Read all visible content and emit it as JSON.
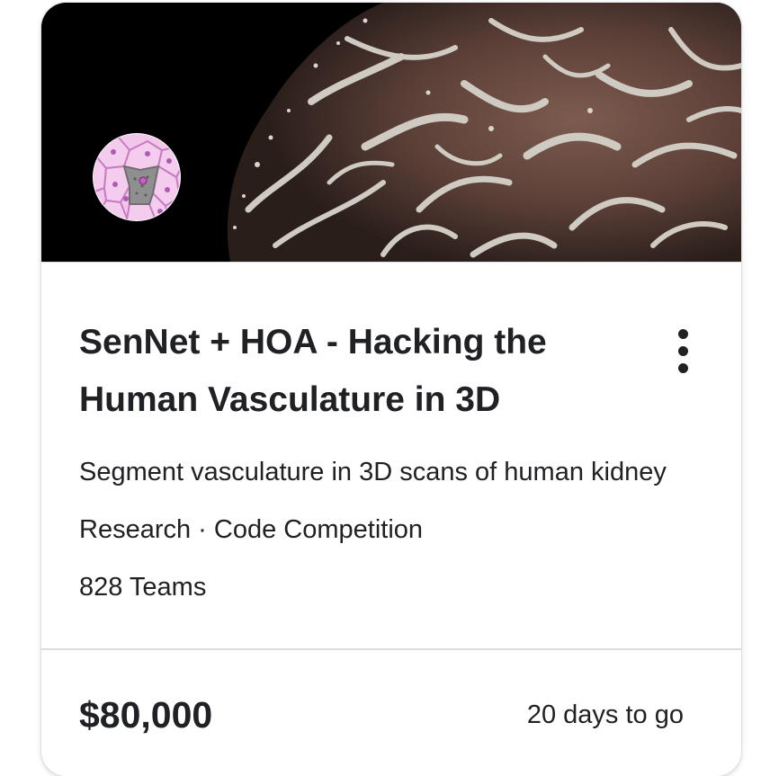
{
  "card": {
    "title": "SenNet + HOA - Hacking the Human Vasculature in 3D",
    "description": "Segment vasculature in 3D scans of human kidney",
    "meta": "Research · Code Competition",
    "teams": "828 Teams",
    "prize": "$80,000",
    "deadline": "20 days to go",
    "banner_icon": "vasculature-3d-render-image",
    "avatar_icon": "cell-tissue-icon",
    "menu_icon": "more-vertical-icon"
  },
  "colors": {
    "text": "#202124",
    "banner_background": "#000000",
    "divider": "#dadce0",
    "avatar_cell_fill": "#f1c6ea",
    "avatar_cell_stroke": "#c77cc1",
    "avatar_nucleus": "#8a8a8a"
  }
}
